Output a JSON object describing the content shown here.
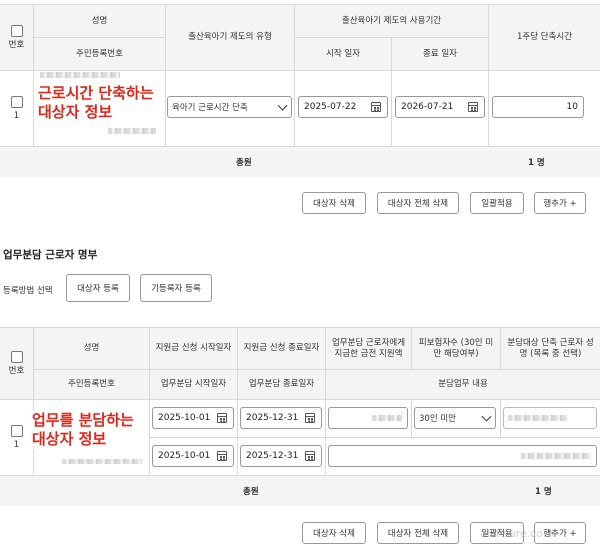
{
  "table1": {
    "headers": {
      "select_label": "번호",
      "name": "성명",
      "rrn": "주민등록번호",
      "type": "출산육아기 제도의 유형",
      "period": "출산육아기 제도의 사용기간",
      "start": "시작 일자",
      "end": "종료 일자",
      "weekly_hours": "1주당 단축시간"
    },
    "row": {
      "number": "1",
      "type_value": "육아기 근로시간 단축",
      "start_date": "2025-07-22",
      "end_date": "2026-07-21",
      "hours": "10",
      "annotation": "근로시간 단축하는 대상자 정보"
    },
    "summary": {
      "label": "총원",
      "count": "1 명"
    },
    "buttons": {
      "delete": "대상자 삭제",
      "delete_all": "대상자 전체 삭제",
      "apply_all": "일괄적용",
      "add_row": "행추가 +"
    }
  },
  "section2": {
    "title": "업무분담 근로자 명부",
    "method_label": "등록방법 선택",
    "register_button": "대상자 등록",
    "existing_button": "기등록자 등록"
  },
  "table2": {
    "headers": {
      "select_label": "번호",
      "name": "성명",
      "rrn": "주민등록번호",
      "apply_start": "지원금 신청 시작일자",
      "apply_end": "지원금 신청 종료일자",
      "share_start": "업무분담 시작일자",
      "share_end": "업무분담 종료일자",
      "amount": "업무분담 근로자에게 지급한 금전 지원액",
      "insured": "피보험자수 (30인 미만 해당여부)",
      "target": "분담대상 단축 근로자 성명 (목록 중 선택)",
      "content": "분담업무 내용"
    },
    "row": {
      "number": "1",
      "apply_start_date": "2025-10-01",
      "apply_end_date": "2025-12-31",
      "share_start_date": "2025-10-01",
      "share_end_date": "2025-12-31",
      "insured_value": "30인 미만",
      "annotation": "업무를 분담하는 대상자 정보"
    },
    "summary": {
      "label": "총원",
      "count": "1 명"
    },
    "buttons": {
      "delete": "대상자 삭제",
      "delete_all": "대상자 전체 삭제",
      "apply_all": "일괄적용",
      "add_row": "행추가 +"
    }
  },
  "watermark": "allinsure.com"
}
